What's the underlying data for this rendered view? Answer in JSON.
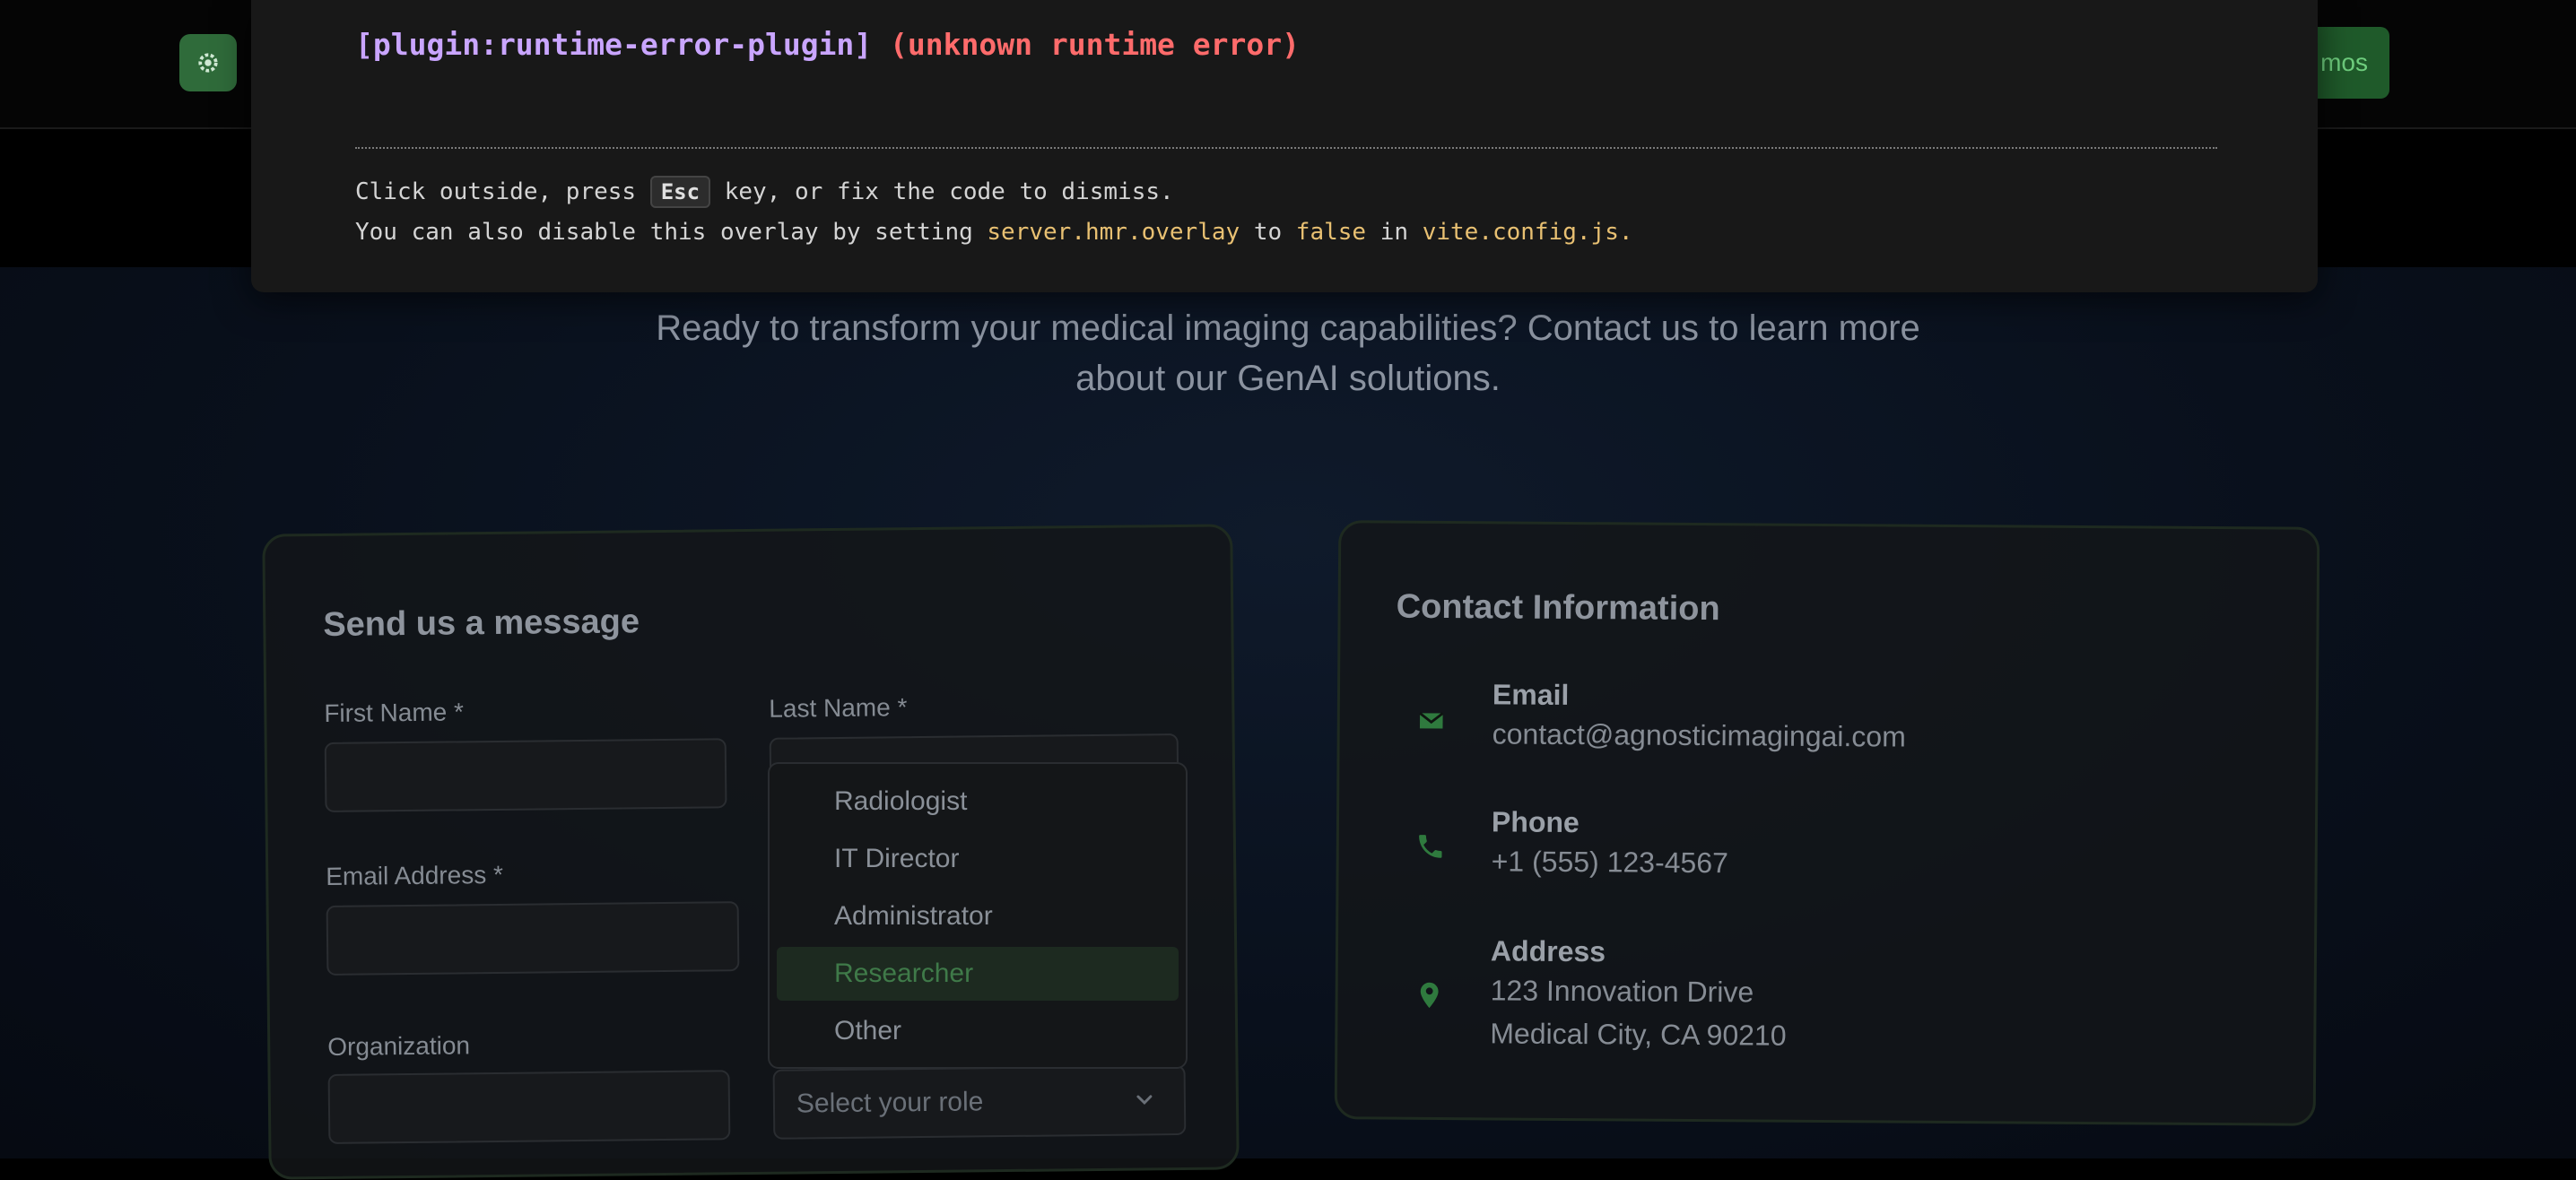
{
  "navbar": {
    "logo_icon": "gear-icon",
    "cta_partial_label": "mos"
  },
  "hero": {
    "subtitle_line1": "Ready to transform your medical imaging capabilities? Contact us to learn more",
    "subtitle_line2": "about our GenAI solutions."
  },
  "form": {
    "title": "Send us a message",
    "first_name_label": "First Name *",
    "last_name_label": "Last Name *",
    "email_label": "Email Address *",
    "organization_label": "Organization",
    "role_placeholder": "Select your role",
    "role_options": [
      "Radiologist",
      "IT Director",
      "Administrator",
      "Researcher",
      "Other"
    ],
    "role_highlighted": "Researcher"
  },
  "contact_info": {
    "title": "Contact Information",
    "email": {
      "heading": "Email",
      "value": "contact@agnosticimagingai.com",
      "icon": "mail-icon"
    },
    "phone": {
      "heading": "Phone",
      "value": "+1 (555) 123-4567",
      "icon": "phone-icon"
    },
    "address": {
      "heading": "Address",
      "line1": "123 Innovation Drive",
      "line2": "Medical City, CA 90210",
      "icon": "location-pin-icon"
    }
  },
  "error_overlay": {
    "plugin": "[plugin:runtime-error-plugin]",
    "message": "(unknown runtime error)",
    "tip1_before": "Click outside, press ",
    "tip1_key": "Esc",
    "tip1_after": " key, or fix the code to dismiss.",
    "tip2_a": "You can also disable this overlay by setting ",
    "tip2_code1": "server.hmr.overlay",
    "tip2_b": " to ",
    "tip2_code2": "false",
    "tip2_c": " in ",
    "tip2_code3": "vite.config.js",
    "tip2_d": "."
  },
  "colors": {
    "accent_green": "#2f6b3a",
    "error_red": "#ff6b6b",
    "plugin_purple": "#c9a5ff",
    "code_yellow": "#e8c072"
  }
}
